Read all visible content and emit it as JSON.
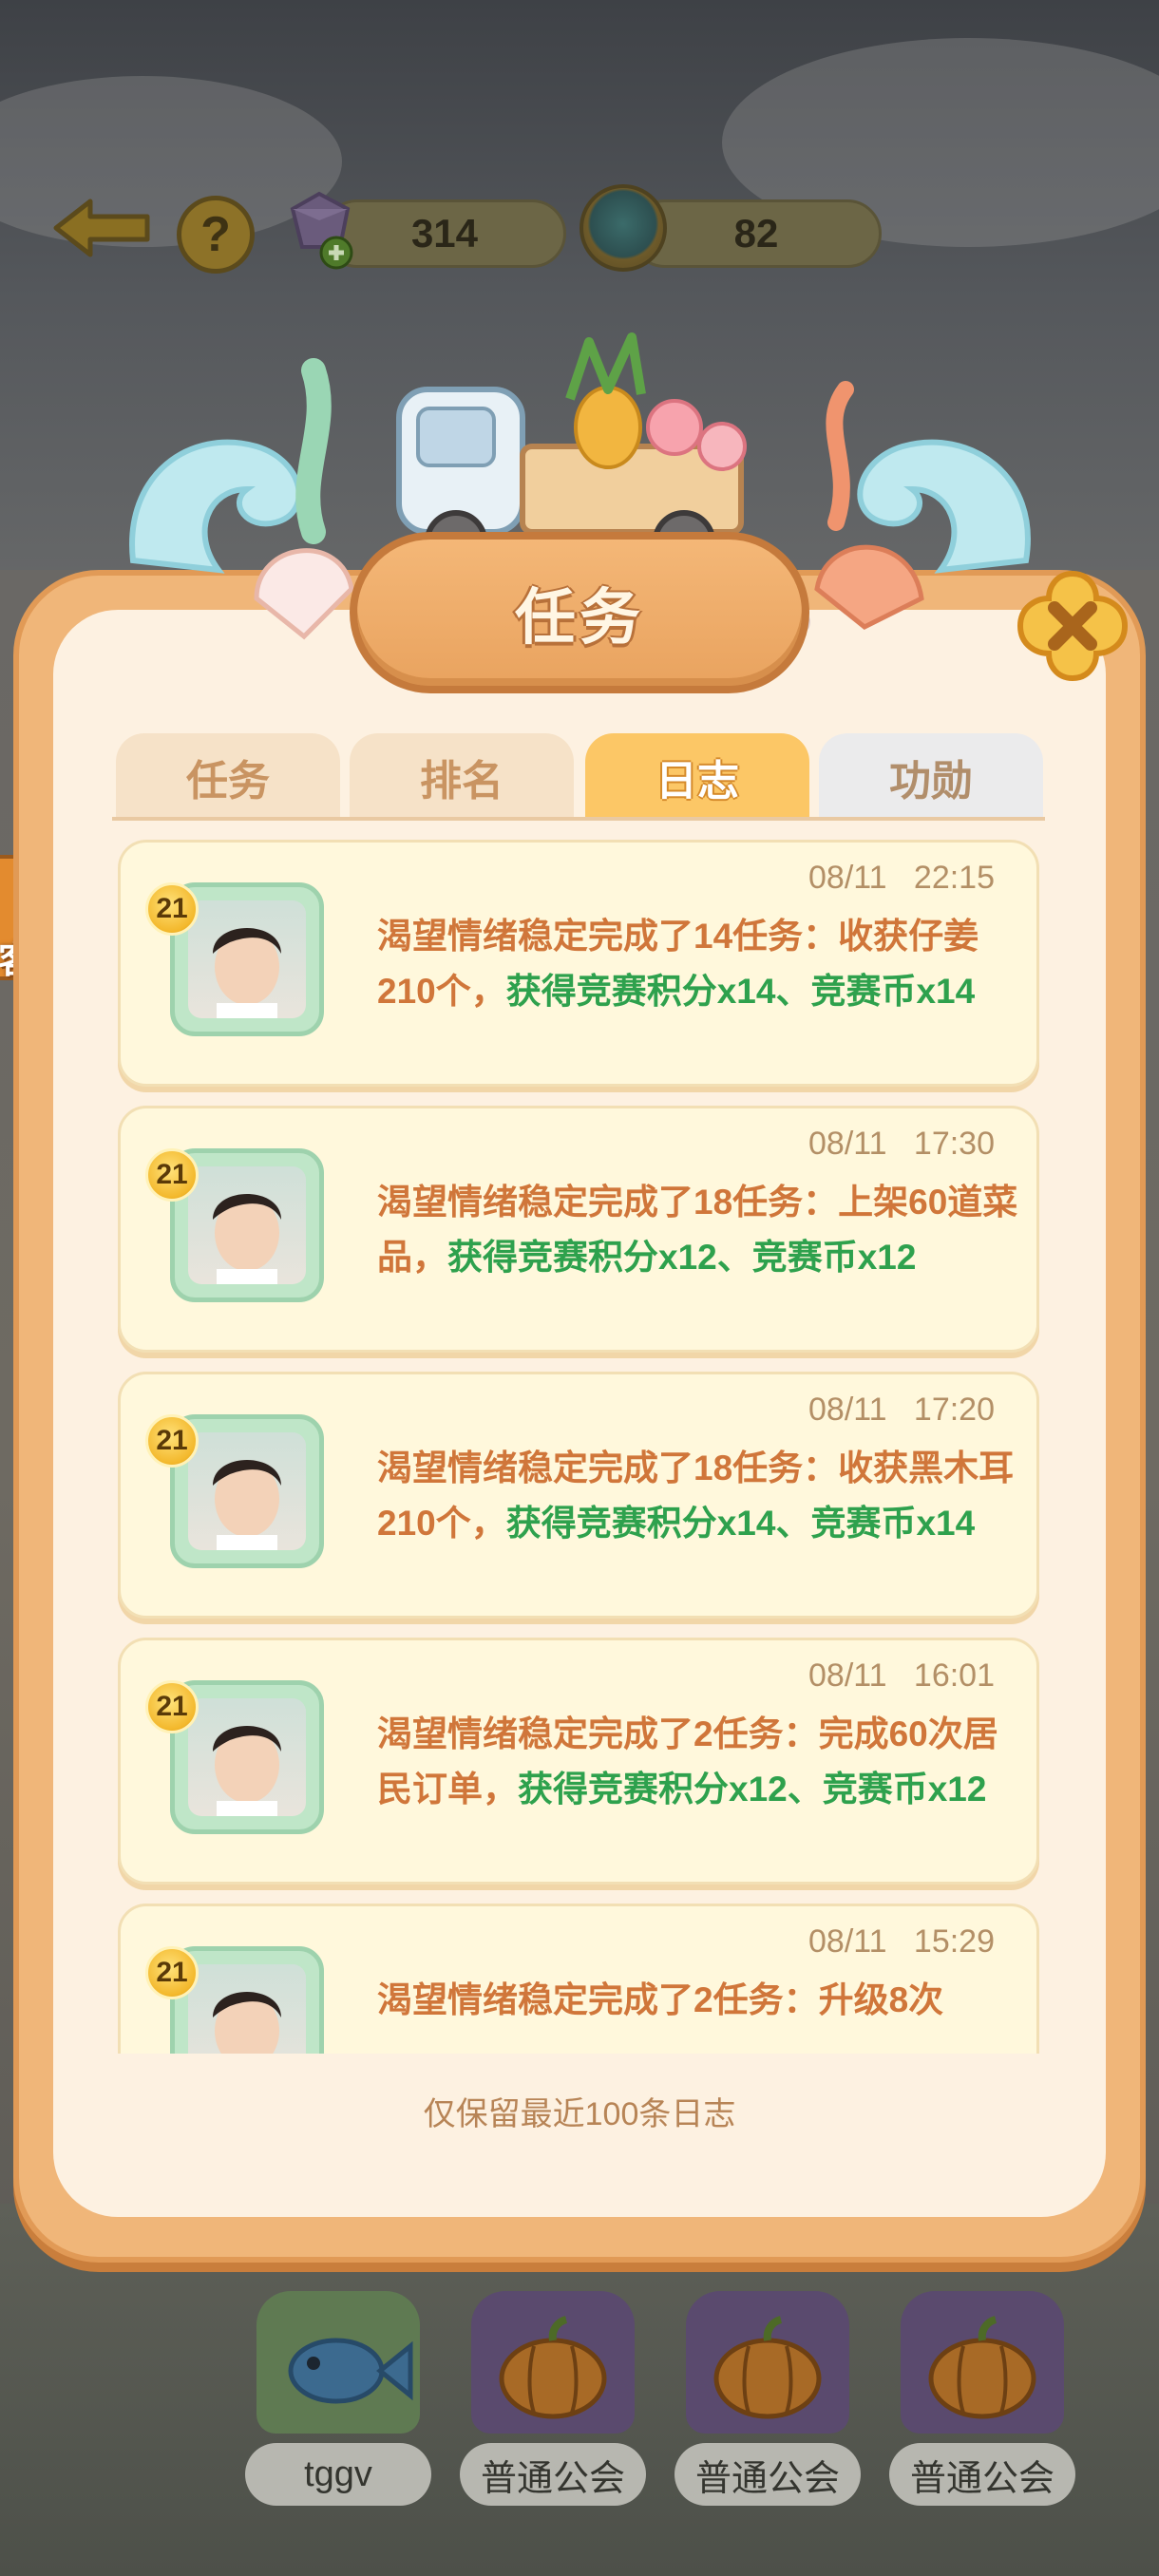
{
  "top_bar": {
    "gems": "314",
    "coins": "82",
    "help_label": "?"
  },
  "side_tab": {
    "service_label": "客服"
  },
  "dialog": {
    "title": "任务",
    "tabs": [
      {
        "label": "任务",
        "state": "normal"
      },
      {
        "label": "排名",
        "state": "normal"
      },
      {
        "label": "日志",
        "state": "active"
      },
      {
        "label": "功勋",
        "state": "grey"
      }
    ],
    "logs": [
      {
        "level": "21",
        "time": "08/11   22:15",
        "player": "渴望情绪稳定",
        "action": "完成了14任务：收获仔姜210个，",
        "reward": "获得竞赛积分x14、竞赛币x14"
      },
      {
        "level": "21",
        "time": "08/11   17:30",
        "player": "渴望情绪稳定",
        "action": "完成了18任务：上架60道菜品，",
        "reward": "获得竞赛积分x12、竞赛币x12"
      },
      {
        "level": "21",
        "time": "08/11   17:20",
        "player": "渴望情绪稳定",
        "action": "完成了18任务：收获黑木耳210个，",
        "reward": "获得竞赛积分x14、竞赛币x14"
      },
      {
        "level": "21",
        "time": "08/11   16:01",
        "player": "渴望情绪稳定",
        "action": "完成了2任务：完成60次居民订单，",
        "reward": "获得竞赛积分x12、竞赛币x12"
      },
      {
        "level": "21",
        "time": "08/11   15:29",
        "player": "渴望情绪稳定",
        "action": "完成了2任务：升级8次",
        "reward": ""
      }
    ],
    "footer_note": "仅保留最近100条日志"
  },
  "guilds": [
    "tggv",
    "普通公会",
    "普通公会",
    "普通公会"
  ],
  "colors": {
    "dialog_border": "#f0b679",
    "dialog_bg": "#fdf1e1",
    "active_tab": "#fcc766",
    "log_player_text": "#d0763a",
    "log_reward_text": "#2ea14d"
  }
}
